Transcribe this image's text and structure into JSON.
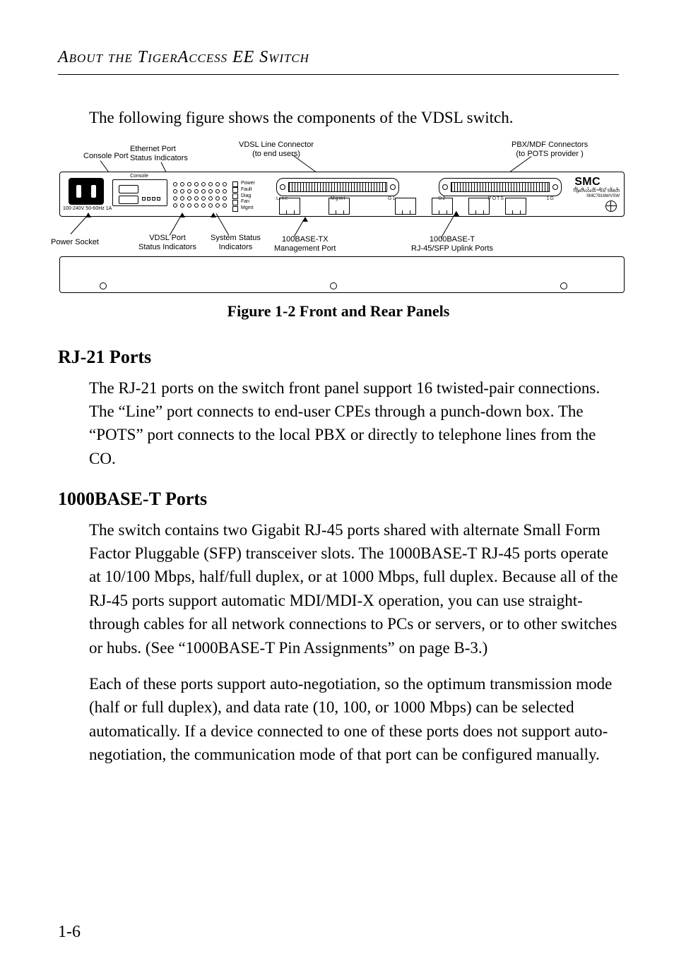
{
  "header": {
    "running_head": "About the TigerAccess EE Switch"
  },
  "intro": "The following figure shows the components of the VDSL switch.",
  "figure": {
    "caption": "Figure 1-2  Front and Rear Panels",
    "labels": {
      "console_port": "Console Port",
      "ethernet_port": "Ethernet Port\nStatus Indicators",
      "vdsl_line": "VDSL Line Connector\n(to end users)",
      "pbx": "PBX/MDF Connectors\n(to POTS provider )",
      "power_socket": "Power Socket",
      "vdsl_port": "VDSL Port\nStatus Indicators",
      "sys_status": "System Status\nIndicators",
      "mgmt": "100BASE-TX\nManagement Port",
      "uplink": "1000BASE-T\nRJ-45/SFP Uplink Ports"
    },
    "panel_text": {
      "console": "Console",
      "brand": "SMC",
      "brand_sub": "N e t w o r k s",
      "model1": "TigerAccess™EE Switch",
      "model2": "SMC7816M/VSW",
      "power_spec": "100-240V 50-60Hz 1A",
      "status_items": [
        "Power",
        "Fault",
        "Diag",
        "Fan",
        "Mgmt"
      ],
      "rj21_left": [
        "Line",
        "Mgmt",
        "G1"
      ],
      "rj21_right": [
        "G2",
        "POTS",
        "1G"
      ]
    }
  },
  "sections": [
    {
      "heading": "RJ-21 Ports",
      "body": "The RJ-21 ports on the switch front panel support 16 twisted-pair connections. The “Line” port connects to end-user CPEs through a punch-down box. The “POTS” port connects to the local PBX or directly to telephone lines from the CO."
    },
    {
      "heading": "1000BASE-T Ports",
      "body": "The switch contains two Gigabit RJ-45 ports shared with alternate Small Form Factor Pluggable (SFP) transceiver slots. The 1000BASE-T RJ-45 ports operate at 10/100 Mbps, half/full duplex, or at 1000 Mbps, full duplex. Because all of the RJ-45 ports support automatic MDI/MDI-X operation, you can use straight-through cables for all network connections to PCs or servers, or to other switches or hubs. (See “1000BASE-T Pin Assignments” on page B-3.)",
      "body2": "Each of these ports support auto-negotiation, so the optimum transmission mode (half or full duplex), and data rate (10, 100, or 1000 Mbps) can be selected automatically. If a device connected to one of these ports does not support auto-negotiation, the communication mode of that port can be configured manually."
    }
  ],
  "page_number": "1-6"
}
